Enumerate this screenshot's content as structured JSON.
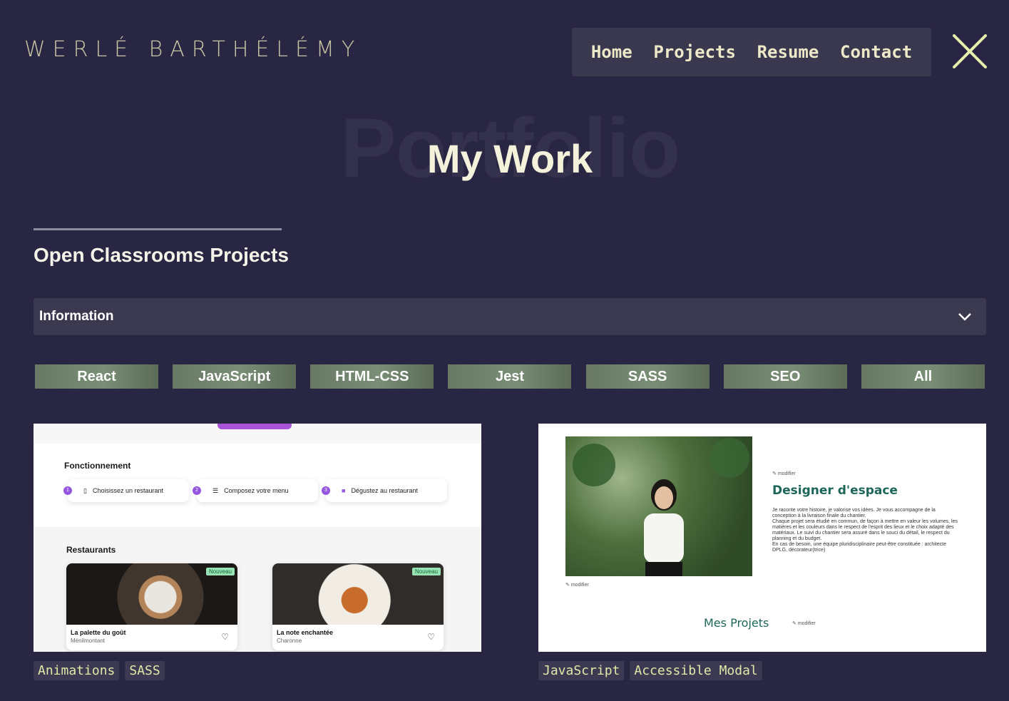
{
  "header": {
    "logo": "WERLÉ BARTHÉLÉMY",
    "nav": [
      "Home",
      "Projects",
      "Resume",
      "Contact"
    ]
  },
  "hero": {
    "background_word": "Portfolio",
    "title": "My Work"
  },
  "section": {
    "title": "Open Classrooms Projects"
  },
  "accordion": {
    "label": "Information"
  },
  "filters": [
    "React",
    "JavaScript",
    "HTML-CSS",
    "Jest",
    "SASS",
    "SEO",
    "All"
  ],
  "projects": [
    {
      "tags": [
        "Animations",
        "SASS"
      ],
      "preview": {
        "section1": "Fonctionnement",
        "steps": [
          "Choisissez un restaurant",
          "Composez votre menu",
          "Dégustez au restaurant"
        ],
        "step_numbers": [
          "1",
          "2",
          "3"
        ],
        "section2": "Restaurants",
        "badge": "Nouveau",
        "restaurants": [
          {
            "name": "La palette du goût",
            "area": "Ménilmontant"
          },
          {
            "name": "La note enchantée",
            "area": "Charonne"
          }
        ]
      }
    },
    {
      "tags": [
        "JavaScript",
        "Accessible Modal"
      ],
      "preview": {
        "edit": "modifier",
        "heading": "Designer d'espace",
        "paragraph1": "Je raconte votre histoire, je valorise vos idées. Je vous accompagne de la conception à la livraison finale du chantier.",
        "paragraph2": "Chaque projet sera étudié en commun, de façon à mettre en valeur les volumes, les matières et les couleurs dans le respect de l'esprit des lieux et le choix adapté des matériaux. Le suivi du chantier sera assuré dans le souci du détail, le respect du planning et du budget.",
        "paragraph3": "En cas de besoin, une équipe pluridisciplinaire peut-être constituée : architecte DPLG, décorateur(trice)",
        "projects_title": "Mes Projets"
      }
    }
  ],
  "colors": {
    "background": "#292644",
    "panel": "#3b394f",
    "accent": "#dfe9a8",
    "filter_green": "#6f8069"
  }
}
